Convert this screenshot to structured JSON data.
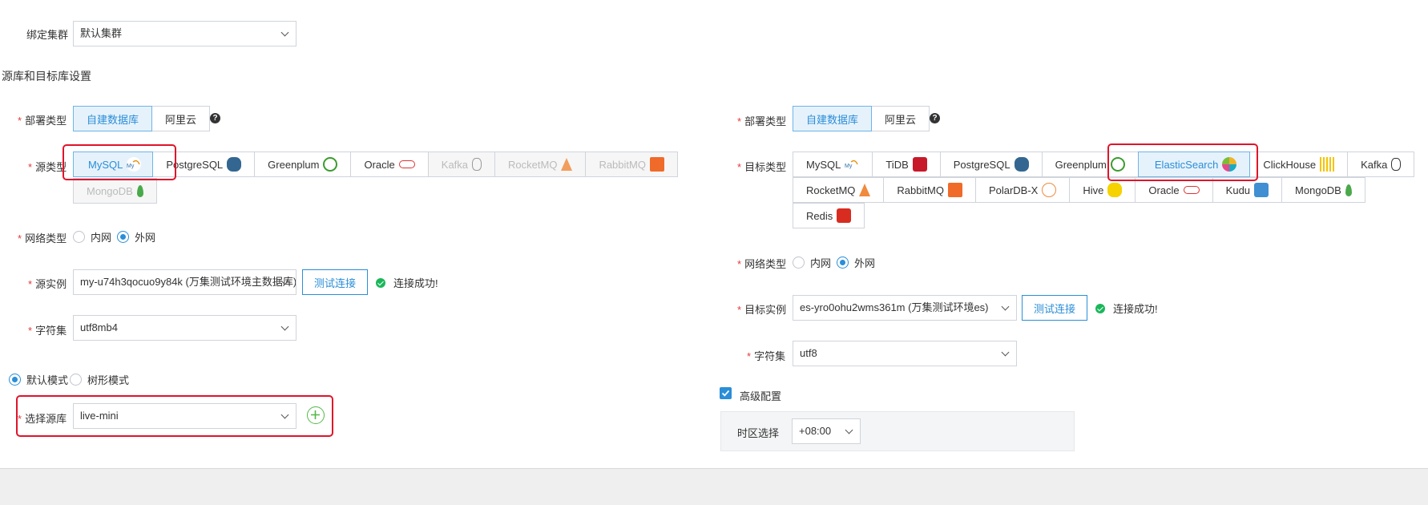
{
  "cluster": {
    "label": "绑定集群",
    "value": "默认集群"
  },
  "section_title": "源库和目标库设置",
  "source": {
    "deploy": {
      "label": "部署类型",
      "options": [
        "自建数据库",
        "阿里云"
      ],
      "selected": "自建数据库"
    },
    "db_type": {
      "label": "源类型",
      "options": [
        "MySQL",
        "PostgreSQL",
        "Greenplum",
        "Oracle",
        "Kafka",
        "RocketMQ",
        "RabbitMQ",
        "MongoDB"
      ],
      "selected": "MySQL",
      "disabled": [
        "Kafka",
        "RocketMQ",
        "RabbitMQ",
        "MongoDB"
      ]
    },
    "network": {
      "label": "网络类型",
      "options": [
        "内网",
        "外网"
      ],
      "selected": "外网"
    },
    "instance": {
      "label": "源实例",
      "value": "my-u74h3qocuo9y84k (万集测试环境主数据库)",
      "test_button": "测试连接",
      "status": "连接成功!"
    },
    "charset": {
      "label": "字符集",
      "value": "utf8mb4"
    },
    "mode": {
      "options": [
        "默认模式",
        "树形模式"
      ],
      "selected": "默认模式"
    },
    "database": {
      "label": "选择源库",
      "value": "live-mini"
    }
  },
  "target": {
    "deploy": {
      "label": "部署类型",
      "options": [
        "自建数据库",
        "阿里云"
      ],
      "selected": "自建数据库"
    },
    "db_type": {
      "label": "目标类型",
      "row1": [
        "MySQL",
        "TiDB",
        "PostgreSQL",
        "Greenplum",
        "ElasticSearch",
        "ClickHouse",
        "Kafka"
      ],
      "row2": [
        "RocketMQ",
        "RabbitMQ",
        "PolarDB-X",
        "Hive",
        "Oracle",
        "Kudu",
        "MongoDB"
      ],
      "row3": [
        "Redis"
      ],
      "selected": "ElasticSearch"
    },
    "network": {
      "label": "网络类型",
      "options": [
        "内网",
        "外网"
      ],
      "selected": "外网"
    },
    "instance": {
      "label": "目标实例",
      "value": "es-yro0ohu2wms361m (万集测试环境es)",
      "test_button": "测试连接",
      "status": "连接成功!"
    },
    "charset": {
      "label": "字符集",
      "value": "utf8"
    },
    "advanced": {
      "label": "高级配置",
      "checked": true
    },
    "timezone": {
      "label": "时区选择",
      "value": "+08:00"
    }
  },
  "colors": {
    "accent": "#2a8ed8",
    "highlight": "#e0142a",
    "success": "#1ab75a",
    "required": "#e4393c"
  }
}
